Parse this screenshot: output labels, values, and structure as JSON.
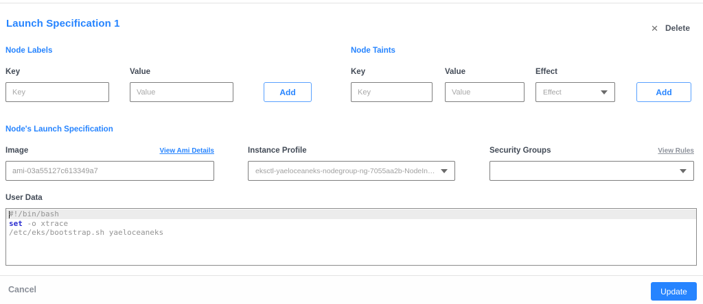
{
  "accent_color": "#2684ff",
  "title": "Launch Specification 1",
  "delete_button": {
    "label": "Delete"
  },
  "node_labels": {
    "heading": "Node Labels",
    "key_label": "Key",
    "key_placeholder": "Key",
    "value_label": "Value",
    "value_placeholder": "Value",
    "add_label": "Add"
  },
  "node_taints": {
    "heading": "Node Taints",
    "key_label": "Key",
    "key_placeholder": "Key",
    "value_label": "Value",
    "value_placeholder": "Value",
    "effect_label": "Effect",
    "effect_placeholder": "Effect",
    "add_label": "Add"
  },
  "launch_spec": {
    "heading": "Node's Launch Specification",
    "image_label": "Image",
    "view_ami_link": "View Ami Details",
    "image_value": "ami-03a55127c613349a7",
    "instance_profile_label": "Instance Profile",
    "instance_profile_value": "eksctl-yaeloceaneks-nodegroup-ng-7055aa2b-NodeInstanceProfile-...",
    "security_groups_label": "Security Groups",
    "view_rules_link": "View Rules",
    "security_groups_value": ""
  },
  "user_data": {
    "label": "User Data",
    "code": {
      "line1": "#!/bin/bash",
      "line2_keyword": "set",
      "line2_rest": " -o xtrace",
      "line3": "/etc/eks/bootstrap.sh yaeloceaneks"
    }
  },
  "footer": {
    "cancel_label": "Cancel",
    "update_label": "Update"
  }
}
